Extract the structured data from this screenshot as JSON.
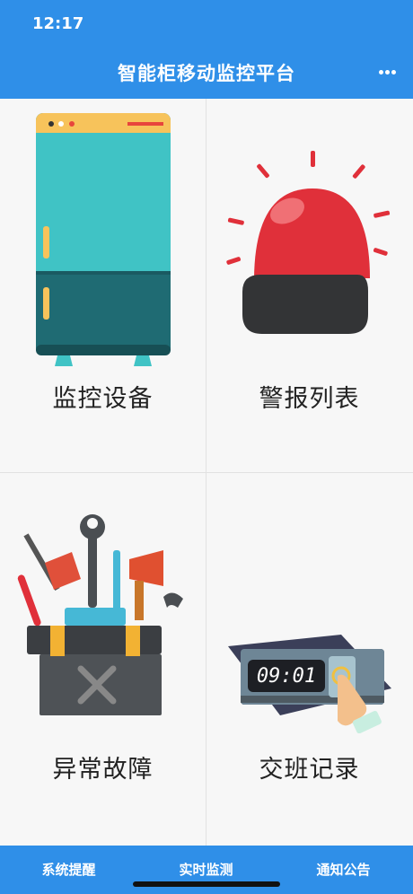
{
  "status_bar": {
    "time": "12:17"
  },
  "header": {
    "title": "智能柜移动监控平台",
    "menu_icon": "more-dots-icon"
  },
  "tiles": [
    {
      "label": "监控设备",
      "icon": "cabinet-icon"
    },
    {
      "label": "警报列表",
      "icon": "alarm-light-icon"
    },
    {
      "label": "异常故障",
      "icon": "toolbox-icon"
    },
    {
      "label": "交班记录",
      "icon": "time-clock-icon"
    }
  ],
  "clock_display": "09:01",
  "tabbar": {
    "items": [
      {
        "label": "系统提醒"
      },
      {
        "label": "实时监测"
      },
      {
        "label": "通知公告"
      }
    ]
  },
  "colors": {
    "primary": "#2f8fe8",
    "cabinet_top": "#3fc4c6",
    "cabinet_bottom": "#1e6a72",
    "alarm_red": "#e0303a"
  }
}
